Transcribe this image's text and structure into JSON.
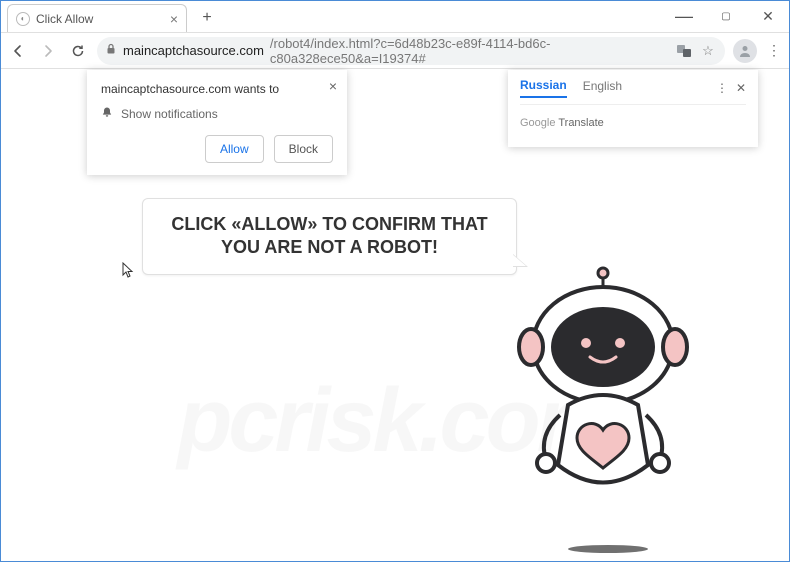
{
  "window": {
    "tab_title": "Click Allow"
  },
  "address": {
    "host": "maincaptchasource.com",
    "path": "/robot4/index.html?c=6d48b23c-e89f-4114-bd6c-c80a328ece50&a=I19374#"
  },
  "permission": {
    "site_line": "maincaptchasource.com wants to",
    "prompt_line": "Show notifications",
    "allow_label": "Allow",
    "block_label": "Block"
  },
  "translate": {
    "tab_active": "Russian",
    "tab_other": "English",
    "brand_g": "Google",
    "brand_t": "Translate"
  },
  "page": {
    "bubble_text": "CLICK «ALLOW» TO CONFIRM THAT YOU ARE NOT A ROBOT!"
  },
  "watermark": "pcrisk.com",
  "colors": {
    "robot_pink": "#f4c4c4",
    "robot_dark": "#2b2b2e"
  }
}
